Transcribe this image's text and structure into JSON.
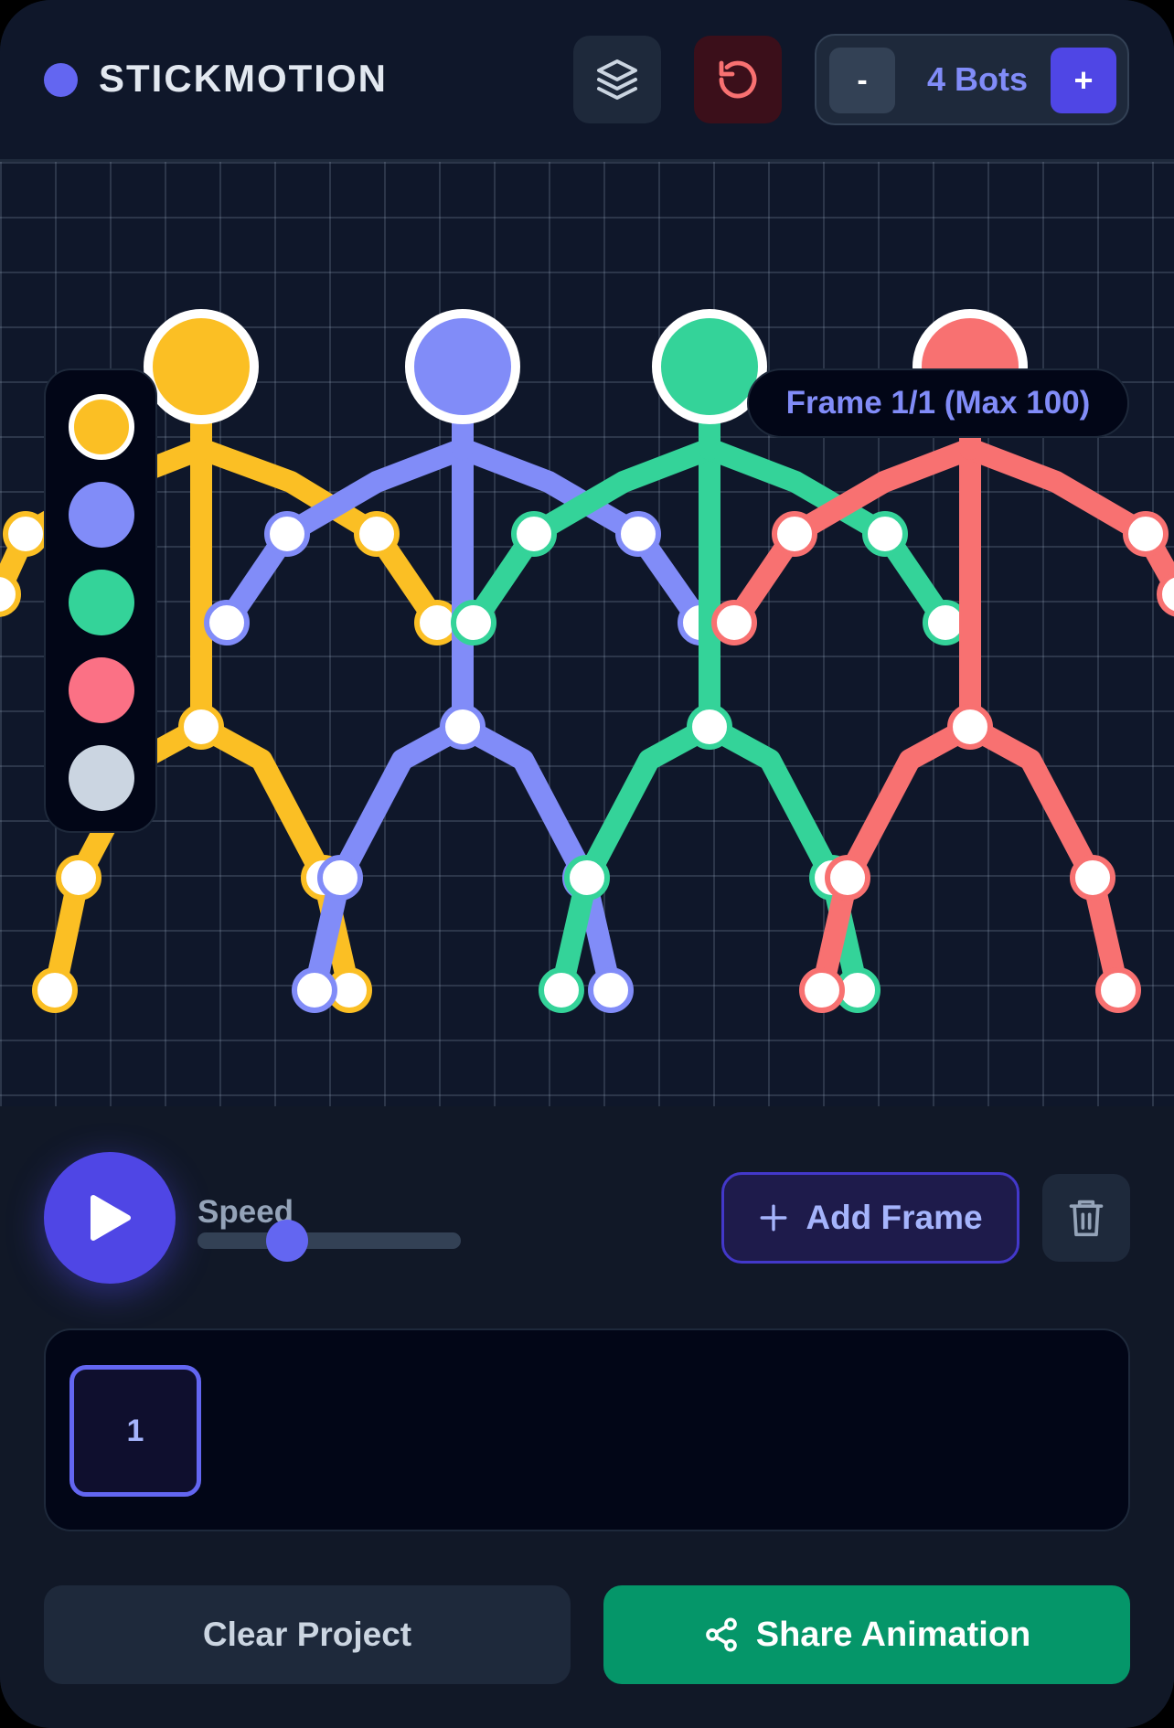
{
  "app": {
    "title": "STICKMOTION",
    "accent": "#6366f1"
  },
  "header": {
    "layers_icon": "layers-icon",
    "reset_icon": "rotate-ccw-icon",
    "bots": {
      "minus_label": "-",
      "count_label": "4 Bots",
      "plus_label": "+"
    }
  },
  "canvas": {
    "frame_badge": "Frame 1/1 (Max 100)",
    "palette": [
      {
        "color": "#fbbf24",
        "selected": true
      },
      {
        "color": "#818cf8",
        "selected": false
      },
      {
        "color": "#34d399",
        "selected": false
      },
      {
        "color": "#fb7185",
        "selected": false
      },
      {
        "color": "#cbd5e1",
        "selected": false
      }
    ],
    "figures": [
      {
        "color": "#fbbf24"
      },
      {
        "color": "#818cf8"
      },
      {
        "color": "#34d399"
      },
      {
        "color": "#f87171"
      }
    ]
  },
  "controls": {
    "play_icon": "play-icon",
    "speed_label": "Speed",
    "speed_value": 0.34,
    "add_frame_label": "Add Frame",
    "trash_icon": "trash-icon"
  },
  "timeline": {
    "frames": [
      "1"
    ]
  },
  "footer": {
    "clear_label": "Clear Project",
    "share_label": "Share Animation",
    "share_icon": "share-icon"
  }
}
